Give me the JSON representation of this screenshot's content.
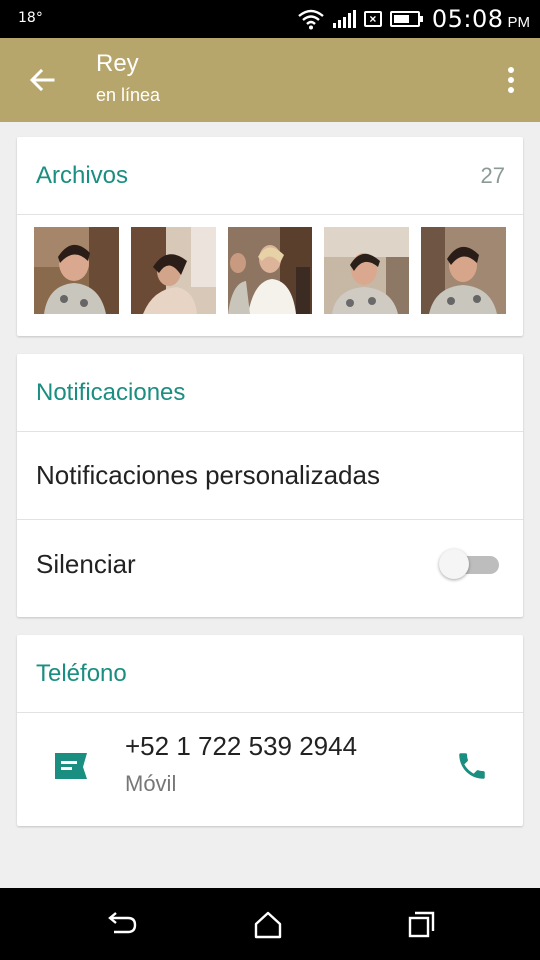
{
  "status_bar": {
    "temperature": "18°",
    "time": "05:08",
    "ampm": "PM"
  },
  "app_bar": {
    "name": "Rey",
    "status": "en línea"
  },
  "media_card": {
    "title": "Archivos",
    "count": "27"
  },
  "notifications_card": {
    "title": "Notificaciones",
    "custom_label": "Notificaciones personalizadas",
    "mute_label": "Silenciar",
    "mute_enabled": false
  },
  "phone_card": {
    "title": "Teléfono",
    "number": "+52 1 722 539 2944",
    "type": "Móvil"
  },
  "colors": {
    "app_bar": "#b7a66b",
    "accent": "#1a8e80",
    "background": "#efefef"
  },
  "icons": [
    "back-arrow-icon",
    "more-vert-icon",
    "message-icon",
    "call-icon",
    "nav-back-icon",
    "nav-home-icon",
    "nav-recents-icon"
  ]
}
